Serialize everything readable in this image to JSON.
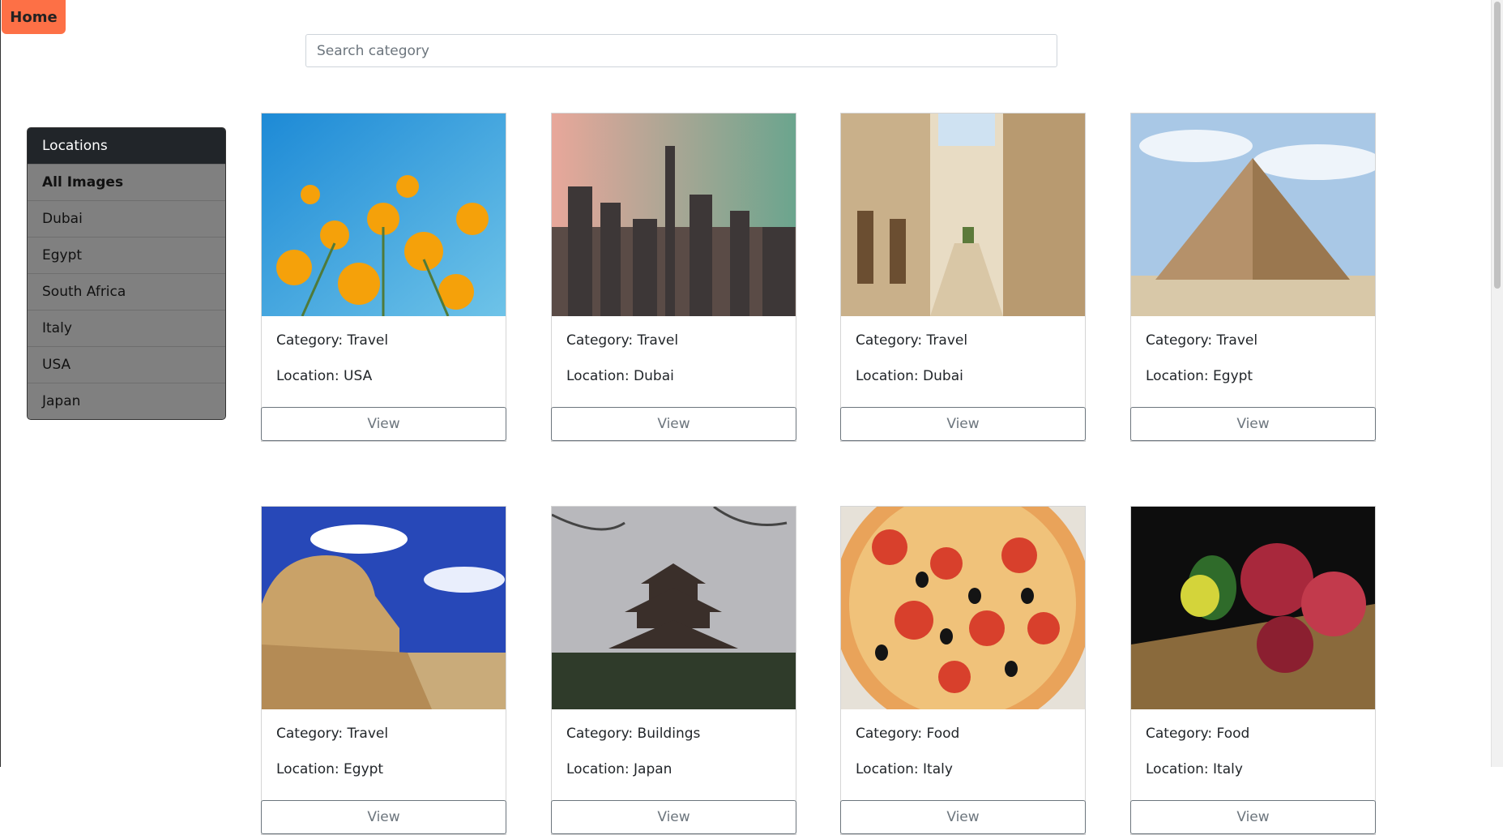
{
  "header": {
    "home_label": "Home"
  },
  "search": {
    "placeholder": "Search category"
  },
  "sidebar": {
    "title": "Locations",
    "items": [
      {
        "label": "All Images",
        "active": true
      },
      {
        "label": "Dubai"
      },
      {
        "label": "Egypt"
      },
      {
        "label": "South Africa"
      },
      {
        "label": "Italy"
      },
      {
        "label": "USA"
      },
      {
        "label": "Japan"
      }
    ]
  },
  "cards": [
    {
      "category": "Category: Travel",
      "location": "Location: USA",
      "view": "View",
      "image": "flowers"
    },
    {
      "category": "Category: Travel",
      "location": "Location: Dubai",
      "view": "View",
      "image": "city"
    },
    {
      "category": "Category: Travel",
      "location": "Location: Dubai",
      "view": "View",
      "image": "alley"
    },
    {
      "category": "Category: Travel",
      "location": "Location: Egypt",
      "view": "View",
      "image": "pyramid"
    },
    {
      "category": "Category: Travel",
      "location": "Location: Egypt",
      "view": "View",
      "image": "sphinx"
    },
    {
      "category": "Category: Buildings",
      "location": "Location: Japan",
      "view": "View",
      "image": "pagoda"
    },
    {
      "category": "Category: Food",
      "location": "Location: Italy",
      "view": "View",
      "image": "pizza"
    },
    {
      "category": "Category: Food",
      "location": "Location: Italy",
      "view": "View",
      "image": "fruit"
    }
  ],
  "colors": {
    "accent": "#fd7046",
    "sidebar_head": "#212529",
    "sidebar_body": "#808080"
  }
}
